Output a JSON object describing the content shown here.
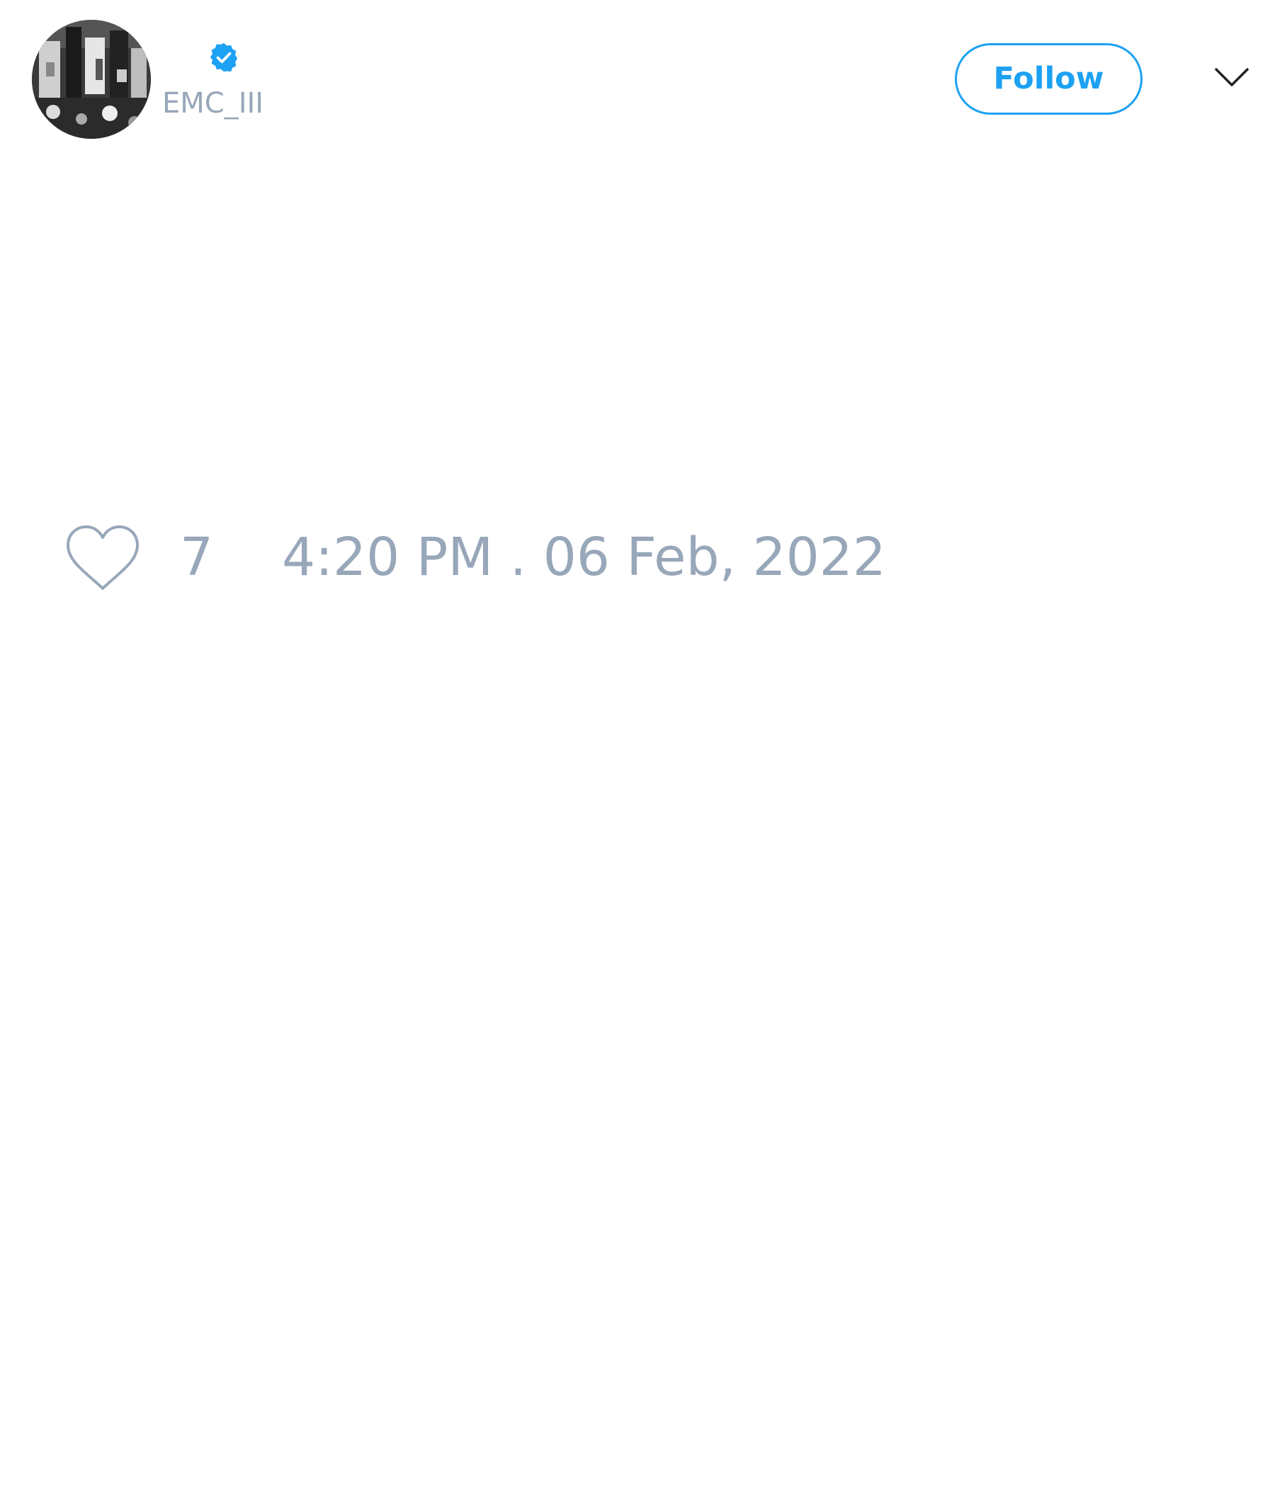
{
  "header": {
    "handle": "EMC_III",
    "verified": true,
    "follow_label": "Follow"
  },
  "tweet": {
    "like_count": "7",
    "timestamp": "4:20 PM . 06 Feb, 2022"
  },
  "icons": {
    "verified": "verified-badge-icon",
    "menu": "chevron-down-icon",
    "like": "heart-icon"
  },
  "colors": {
    "accent": "#1da1f2",
    "muted_text": "#98a7b9",
    "background": "#ffffff"
  }
}
